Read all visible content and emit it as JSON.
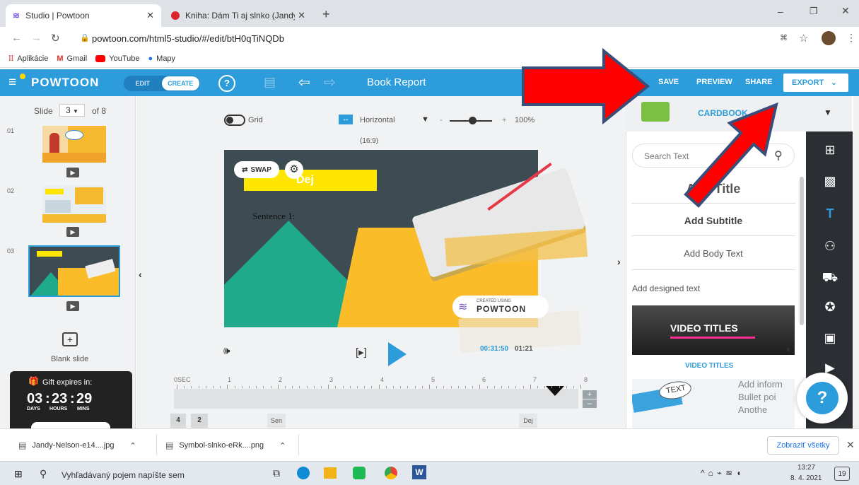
{
  "browser": {
    "tabs": [
      {
        "title": "Studio | Powtoon"
      },
      {
        "title": "Kniha: Dám Ti aj slnko (Jandy Nel"
      }
    ],
    "url": "powtoon.com/html5-studio/#/edit/btH0qTiNQDb",
    "bookmarks": [
      "Aplikácie",
      "Gmail",
      "YouTube",
      "Mapy"
    ]
  },
  "powtoon": {
    "brand": "POWTOON",
    "mode_edit": "EDIT",
    "mode_create": "CREATE",
    "help_icon": "question-circle-icon",
    "project_title": "Book Report",
    "save": "SAVE",
    "preview": "PREVIEW",
    "share": "SHARE",
    "export": "EXPORT"
  },
  "slides_panel": {
    "slide_label": "Slide",
    "slide_current": "3",
    "slide_total": "of 8",
    "slide_nums": [
      "01",
      "02",
      "03"
    ],
    "blank_slide": "Blank slide",
    "gift_title": "Gift expires in:",
    "countdown": {
      "days": "03",
      "hours": "23",
      "mins": "29"
    },
    "countdown_labels": {
      "days": "DAYS",
      "hours": "HOURS",
      "mins": "MINS"
    }
  },
  "canvas": {
    "grid_label": "Grid",
    "orientation": "Horizontal",
    "ratio": "(16:9)",
    "zoom": "100%",
    "zoom_minus": "-",
    "zoom_plus": "+",
    "swap_label": "SWAP",
    "slide_title": "Dej",
    "sentence": "Sentence 1:",
    "watermark_small": "CREATED USING",
    "watermark_brand": "POWTOON",
    "time_current": "00:31:50",
    "time_total": "01:21"
  },
  "timeline": {
    "ticks": [
      "0SEC",
      "1",
      "2",
      "3",
      "4",
      "5",
      "6",
      "7",
      "8"
    ],
    "markers": [
      "4",
      "2",
      "Sen",
      "Dej"
    ]
  },
  "right_panel": {
    "category": "CARDBOOK",
    "search_placeholder": "Search Text",
    "add_title": "Add Title",
    "add_subtitle": "Add Subtitle",
    "add_body": "Add Body Text",
    "designed_label": "Add designed text",
    "video_titles_banner": "VIDEO TITLES",
    "video_titles_label": "VIDEO TITLES",
    "bubble_text": "TEXT",
    "bullet_lines": [
      "Add inform",
      "Bullet poi",
      "Anothe"
    ],
    "help": "?"
  },
  "downloads": {
    "items": [
      "Jandy-Nelson-e14....jpg",
      "Symbol-slnko-eRk....png"
    ],
    "show_all": "Zobraziť všetky"
  },
  "taskbar": {
    "search_placeholder": "Vyhľadávaný pojem napíšte sem",
    "time": "13:27",
    "date": "8. 4. 2021",
    "notifications": "19"
  },
  "colors": {
    "powtoon_blue": "#2d9cdb",
    "arrow_red": "#ff0000",
    "arrow_outline": "#3a4e7a",
    "slide_bg": "#3d4c53",
    "slide_yellow": "#fbbc2a",
    "slide_teal": "#1faa8c",
    "title_yellow": "#ffe600"
  }
}
